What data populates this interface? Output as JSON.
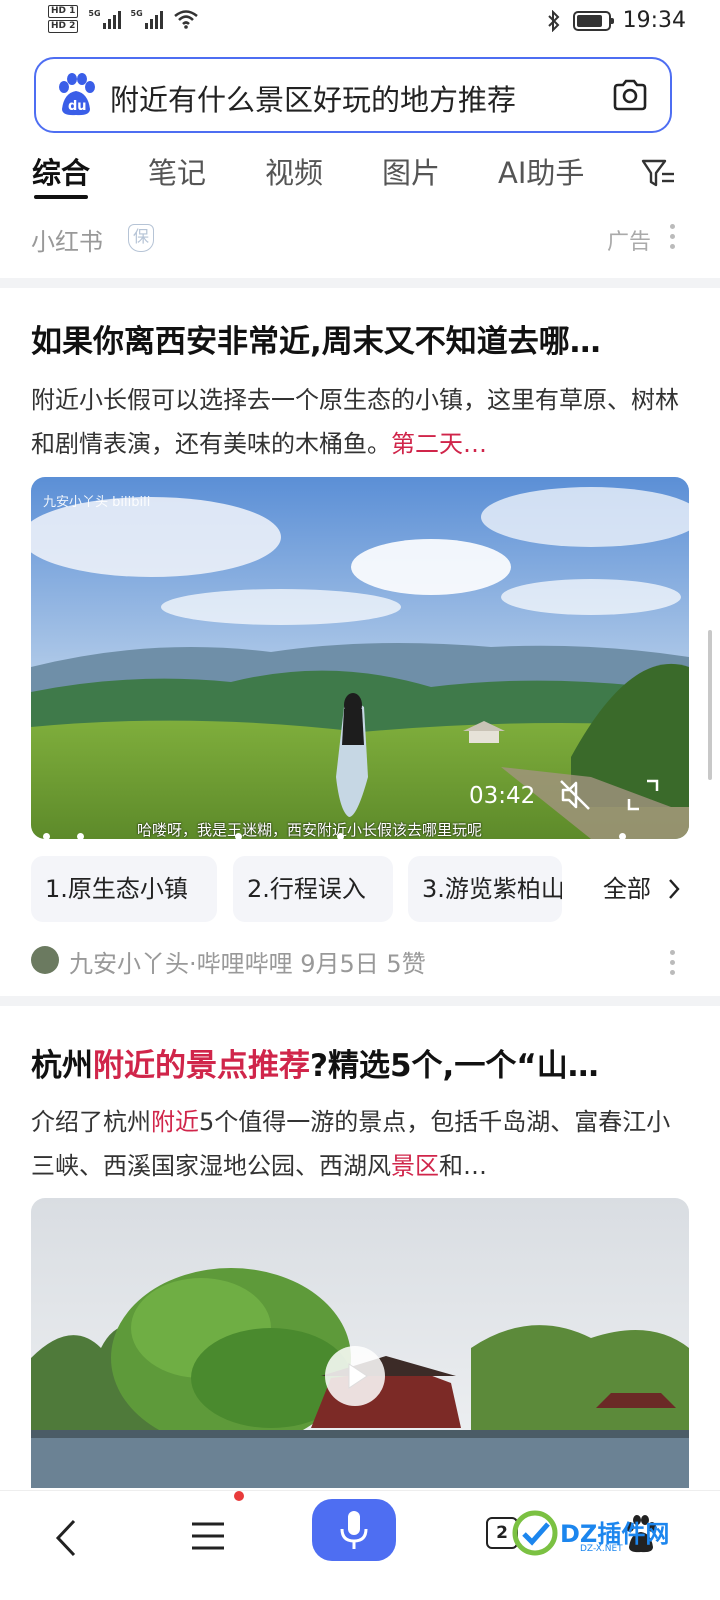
{
  "status_bar": {
    "hd1": "HD 1",
    "hd2": "HD 2",
    "net1": "5G",
    "net2": "5G",
    "time": "19:34",
    "battery_level": 0.85
  },
  "search": {
    "query": "附近有什么景区好玩的地方推荐"
  },
  "tabs": [
    {
      "label": "综合",
      "active": true
    },
    {
      "label": "笔记",
      "active": false
    },
    {
      "label": "视频",
      "active": false
    },
    {
      "label": "图片",
      "active": false
    },
    {
      "label": "AI助手",
      "active": false
    }
  ],
  "ad_source": {
    "name": "小红书",
    "badge": "保",
    "ad_label": "广告"
  },
  "result1": {
    "title": "如果你离西安非常近,周末又不知道去哪…",
    "desc_plain": "附近小长假可以选择去一个原生态的小镇，这里有草原、树林和剧情表演，还有美味的木桶鱼。",
    "desc_highlight": "第二天…",
    "video": {
      "watermark": "九安小丫头 bilibili",
      "duration": "03:42",
      "subtitle": "哈喽呀，我是王迷糊，西安附近小长假该去哪里玩呢"
    },
    "chapters": [
      "1.原生态小镇",
      "2.行程误入",
      "3.游览紫柏山"
    ],
    "chapters_all": "全部",
    "meta": "九安小丫头·哔哩哔哩  9月5日  5赞"
  },
  "result2": {
    "title_parts": [
      {
        "text": "杭州",
        "hl": false
      },
      {
        "text": "附近的景点推荐",
        "hl": true
      },
      {
        "text": "?精选5个,一个“山…",
        "hl": false
      }
    ],
    "desc_parts": [
      {
        "text": "介绍了杭州",
        "hl": false
      },
      {
        "text": "附近",
        "hl": true
      },
      {
        "text": "5个值得一游的景点，包括千岛湖、富春江小三峡、西溪国家湿地公园、西湖风",
        "hl": false
      },
      {
        "text": "景区",
        "hl": true
      },
      {
        "text": "和…",
        "hl": false
      }
    ]
  },
  "bottom_nav": {
    "tab_count": "2"
  },
  "watermark": {
    "text": "DZ插件网",
    "sub": "DZ-X.NET"
  },
  "colors": {
    "accent": "#4e6ef2",
    "highlight": "#d0254a"
  }
}
